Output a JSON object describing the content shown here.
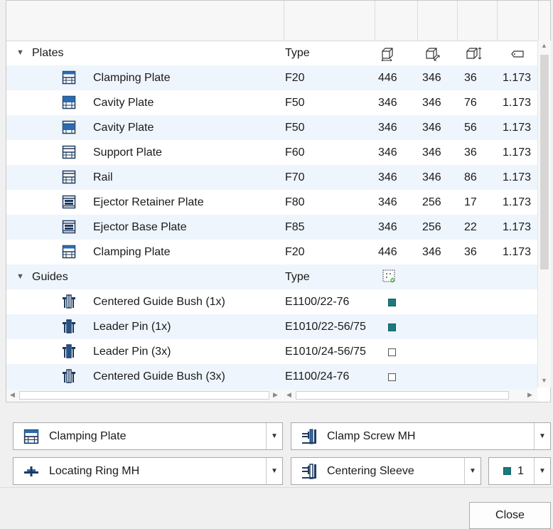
{
  "table": {
    "groups": [
      {
        "label": "Plates",
        "type_header": "Type",
        "rows": [
          {
            "label": "Clamping Plate",
            "icon": "plate-icon",
            "type": "F20",
            "a": "446",
            "b": "346",
            "c": "36",
            "d": "1.173"
          },
          {
            "label": "Cavity Plate",
            "icon": "cavity-plate-icon",
            "type": "F50",
            "a": "346",
            "b": "346",
            "c": "76",
            "d": "1.173"
          },
          {
            "label": "Cavity Plate",
            "icon": "cavity-plate-icon",
            "type": "F50",
            "a": "346",
            "b": "346",
            "c": "56",
            "d": "1.173"
          },
          {
            "label": "Support Plate",
            "icon": "plate-icon",
            "type": "F60",
            "a": "346",
            "b": "346",
            "c": "36",
            "d": "1.173"
          },
          {
            "label": "Rail",
            "icon": "plate-icon",
            "type": "F70",
            "a": "346",
            "b": "346",
            "c": "86",
            "d": "1.173"
          },
          {
            "label": "Ejector Retainer Plate",
            "icon": "ejector-plate-icon",
            "type": "F80",
            "a": "346",
            "b": "256",
            "c": "17",
            "d": "1.173"
          },
          {
            "label": "Ejector Base Plate",
            "icon": "ejector-plate-icon",
            "type": "F85",
            "a": "346",
            "b": "256",
            "c": "22",
            "d": "1.173"
          },
          {
            "label": "Clamping Plate",
            "icon": "plate-icon",
            "type": "F20",
            "a": "446",
            "b": "346",
            "c": "36",
            "d": "1.173"
          }
        ]
      },
      {
        "label": "Guides",
        "type_header": "Type",
        "rows": [
          {
            "label": "Centered Guide Bush (1x)",
            "icon": "guide-bush-icon",
            "type": "E1100/22-76",
            "checked": true
          },
          {
            "label": "Leader Pin (1x)",
            "icon": "leader-pin-icon",
            "type": "E1010/22-56/75",
            "checked": true
          },
          {
            "label": "Leader Pin (3x)",
            "icon": "leader-pin-icon",
            "type": "E1010/24-56/75",
            "checked": false
          },
          {
            "label": "Centered Guide Bush (3x)",
            "icon": "guide-bush-icon",
            "type": "E1100/24-76",
            "checked": false
          }
        ]
      }
    ],
    "column_icons": [
      "width-dimension-icon",
      "depth-dimension-icon",
      "height-dimension-icon",
      "material-tag-icon",
      "guide-settings-icon"
    ]
  },
  "combos": {
    "plate_select": {
      "value": "Clamping Plate",
      "icon": "plate-icon"
    },
    "screw_select": {
      "value": "Clamp Screw MH",
      "icon": "clamp-screw-icon"
    },
    "ring_select": {
      "value": "Locating Ring MH",
      "icon": "locating-ring-icon"
    },
    "sleeve_select": {
      "value": "Centering Sleeve",
      "icon": "centering-sleeve-icon"
    },
    "count_select": {
      "value": "1",
      "swatch_color": "#1a7a80"
    }
  },
  "buttons": {
    "close": "Close"
  },
  "colors": {
    "accent": "#1a7a80",
    "row_alt": "#eef5fc",
    "icon_blue": "#2b6cb0"
  }
}
